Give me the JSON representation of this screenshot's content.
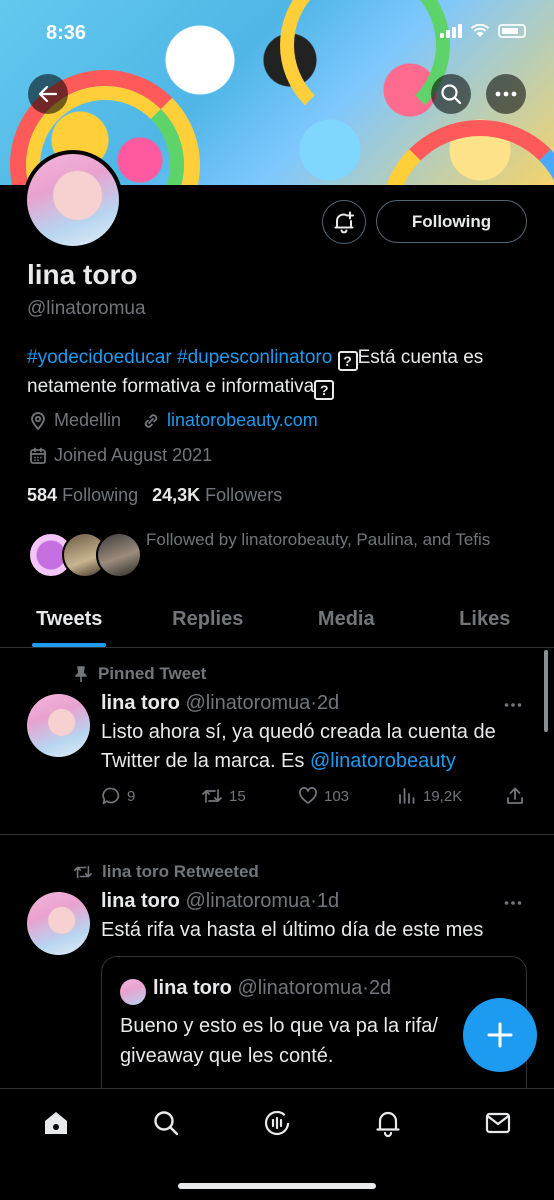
{
  "status_bar": {
    "time": "8:36"
  },
  "profile": {
    "name": "lina toro",
    "handle": "@linatoromua",
    "bio": {
      "hashtag1": "#yodecidoeducar",
      "hashtag2": "#dupesconlinatoro",
      "box_glyph": "?",
      "text1": "Está cuenta es netamente formativa e informativa"
    },
    "location": "Medellin",
    "website": "linatorobeauty.com",
    "joined": "Joined August 2021",
    "following_count": "584",
    "following_label": "Following",
    "followers_count": "24,3K",
    "followers_label": "Followers",
    "followed_by": "Followed by linatorobeauty, Paulina, and Tefis",
    "follow_button": "Following"
  },
  "tabs": [
    {
      "label": "Tweets",
      "active": true
    },
    {
      "label": "Replies",
      "active": false
    },
    {
      "label": "Media",
      "active": false
    },
    {
      "label": "Likes",
      "active": false
    }
  ],
  "tweets": [
    {
      "context": "Pinned Tweet",
      "author": "lina toro",
      "handle": "@linatoromua",
      "sep": "·",
      "time": "2d",
      "text": "Listo ahora sí, ya quedó creada la cuenta de Twitter de la marca. Es ",
      "mention": "@linatorobeauty",
      "replies": "9",
      "retweets": "15",
      "likes": "103",
      "views": "19,2K"
    },
    {
      "context": "lina toro Retweeted",
      "author": "lina toro",
      "handle": "@linatoromua",
      "sep": "·",
      "time": "1d",
      "text": "Está rifa va hasta el último día de este mes",
      "quote": {
        "author": "lina toro",
        "handle": "@linatoromua",
        "sep": "·",
        "time": "2d",
        "text": "Bueno y esto es lo que va pa la rifa/ giveaway que les conté."
      }
    }
  ],
  "icons": {
    "back": "arrow-left-icon",
    "search": "search-icon",
    "more": "more-icon",
    "bell": "bell-plus-icon",
    "compose": "plus-icon",
    "nav": [
      "home-icon",
      "search-icon",
      "spaces-icon",
      "notifications-icon",
      "messages-icon"
    ]
  },
  "colors": {
    "accent": "#1d9bf0",
    "background": "#000000",
    "secondary_text": "#71767b",
    "divider": "#2f3336"
  }
}
